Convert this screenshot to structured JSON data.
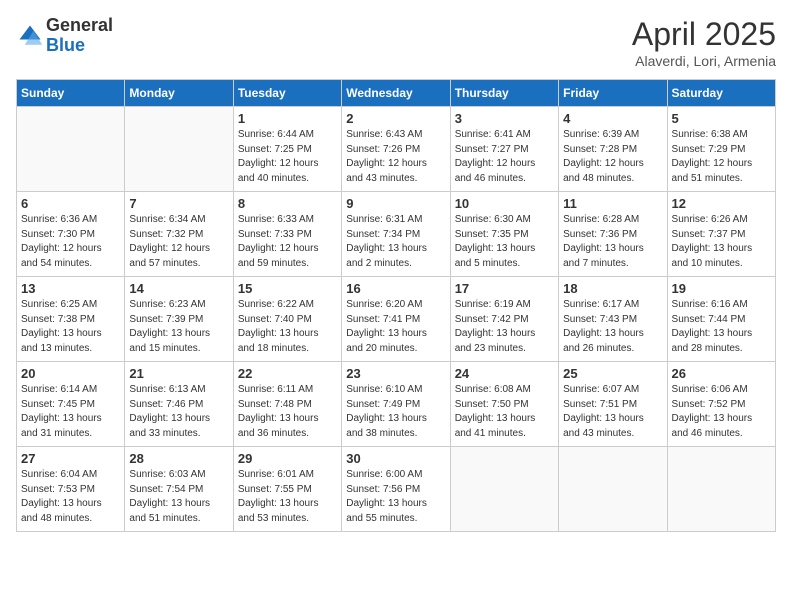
{
  "logo": {
    "general": "General",
    "blue": "Blue"
  },
  "header": {
    "title": "April 2025",
    "subtitle": "Alaverdi, Lori, Armenia"
  },
  "weekdays": [
    "Sunday",
    "Monday",
    "Tuesday",
    "Wednesday",
    "Thursday",
    "Friday",
    "Saturday"
  ],
  "weeks": [
    [
      {
        "day": "",
        "info": ""
      },
      {
        "day": "",
        "info": ""
      },
      {
        "day": "1",
        "info": "Sunrise: 6:44 AM\nSunset: 7:25 PM\nDaylight: 12 hours and 40 minutes."
      },
      {
        "day": "2",
        "info": "Sunrise: 6:43 AM\nSunset: 7:26 PM\nDaylight: 12 hours and 43 minutes."
      },
      {
        "day": "3",
        "info": "Sunrise: 6:41 AM\nSunset: 7:27 PM\nDaylight: 12 hours and 46 minutes."
      },
      {
        "day": "4",
        "info": "Sunrise: 6:39 AM\nSunset: 7:28 PM\nDaylight: 12 hours and 48 minutes."
      },
      {
        "day": "5",
        "info": "Sunrise: 6:38 AM\nSunset: 7:29 PM\nDaylight: 12 hours and 51 minutes."
      }
    ],
    [
      {
        "day": "6",
        "info": "Sunrise: 6:36 AM\nSunset: 7:30 PM\nDaylight: 12 hours and 54 minutes."
      },
      {
        "day": "7",
        "info": "Sunrise: 6:34 AM\nSunset: 7:32 PM\nDaylight: 12 hours and 57 minutes."
      },
      {
        "day": "8",
        "info": "Sunrise: 6:33 AM\nSunset: 7:33 PM\nDaylight: 12 hours and 59 minutes."
      },
      {
        "day": "9",
        "info": "Sunrise: 6:31 AM\nSunset: 7:34 PM\nDaylight: 13 hours and 2 minutes."
      },
      {
        "day": "10",
        "info": "Sunrise: 6:30 AM\nSunset: 7:35 PM\nDaylight: 13 hours and 5 minutes."
      },
      {
        "day": "11",
        "info": "Sunrise: 6:28 AM\nSunset: 7:36 PM\nDaylight: 13 hours and 7 minutes."
      },
      {
        "day": "12",
        "info": "Sunrise: 6:26 AM\nSunset: 7:37 PM\nDaylight: 13 hours and 10 minutes."
      }
    ],
    [
      {
        "day": "13",
        "info": "Sunrise: 6:25 AM\nSunset: 7:38 PM\nDaylight: 13 hours and 13 minutes."
      },
      {
        "day": "14",
        "info": "Sunrise: 6:23 AM\nSunset: 7:39 PM\nDaylight: 13 hours and 15 minutes."
      },
      {
        "day": "15",
        "info": "Sunrise: 6:22 AM\nSunset: 7:40 PM\nDaylight: 13 hours and 18 minutes."
      },
      {
        "day": "16",
        "info": "Sunrise: 6:20 AM\nSunset: 7:41 PM\nDaylight: 13 hours and 20 minutes."
      },
      {
        "day": "17",
        "info": "Sunrise: 6:19 AM\nSunset: 7:42 PM\nDaylight: 13 hours and 23 minutes."
      },
      {
        "day": "18",
        "info": "Sunrise: 6:17 AM\nSunset: 7:43 PM\nDaylight: 13 hours and 26 minutes."
      },
      {
        "day": "19",
        "info": "Sunrise: 6:16 AM\nSunset: 7:44 PM\nDaylight: 13 hours and 28 minutes."
      }
    ],
    [
      {
        "day": "20",
        "info": "Sunrise: 6:14 AM\nSunset: 7:45 PM\nDaylight: 13 hours and 31 minutes."
      },
      {
        "day": "21",
        "info": "Sunrise: 6:13 AM\nSunset: 7:46 PM\nDaylight: 13 hours and 33 minutes."
      },
      {
        "day": "22",
        "info": "Sunrise: 6:11 AM\nSunset: 7:48 PM\nDaylight: 13 hours and 36 minutes."
      },
      {
        "day": "23",
        "info": "Sunrise: 6:10 AM\nSunset: 7:49 PM\nDaylight: 13 hours and 38 minutes."
      },
      {
        "day": "24",
        "info": "Sunrise: 6:08 AM\nSunset: 7:50 PM\nDaylight: 13 hours and 41 minutes."
      },
      {
        "day": "25",
        "info": "Sunrise: 6:07 AM\nSunset: 7:51 PM\nDaylight: 13 hours and 43 minutes."
      },
      {
        "day": "26",
        "info": "Sunrise: 6:06 AM\nSunset: 7:52 PM\nDaylight: 13 hours and 46 minutes."
      }
    ],
    [
      {
        "day": "27",
        "info": "Sunrise: 6:04 AM\nSunset: 7:53 PM\nDaylight: 13 hours and 48 minutes."
      },
      {
        "day": "28",
        "info": "Sunrise: 6:03 AM\nSunset: 7:54 PM\nDaylight: 13 hours and 51 minutes."
      },
      {
        "day": "29",
        "info": "Sunrise: 6:01 AM\nSunset: 7:55 PM\nDaylight: 13 hours and 53 minutes."
      },
      {
        "day": "30",
        "info": "Sunrise: 6:00 AM\nSunset: 7:56 PM\nDaylight: 13 hours and 55 minutes."
      },
      {
        "day": "",
        "info": ""
      },
      {
        "day": "",
        "info": ""
      },
      {
        "day": "",
        "info": ""
      }
    ]
  ]
}
